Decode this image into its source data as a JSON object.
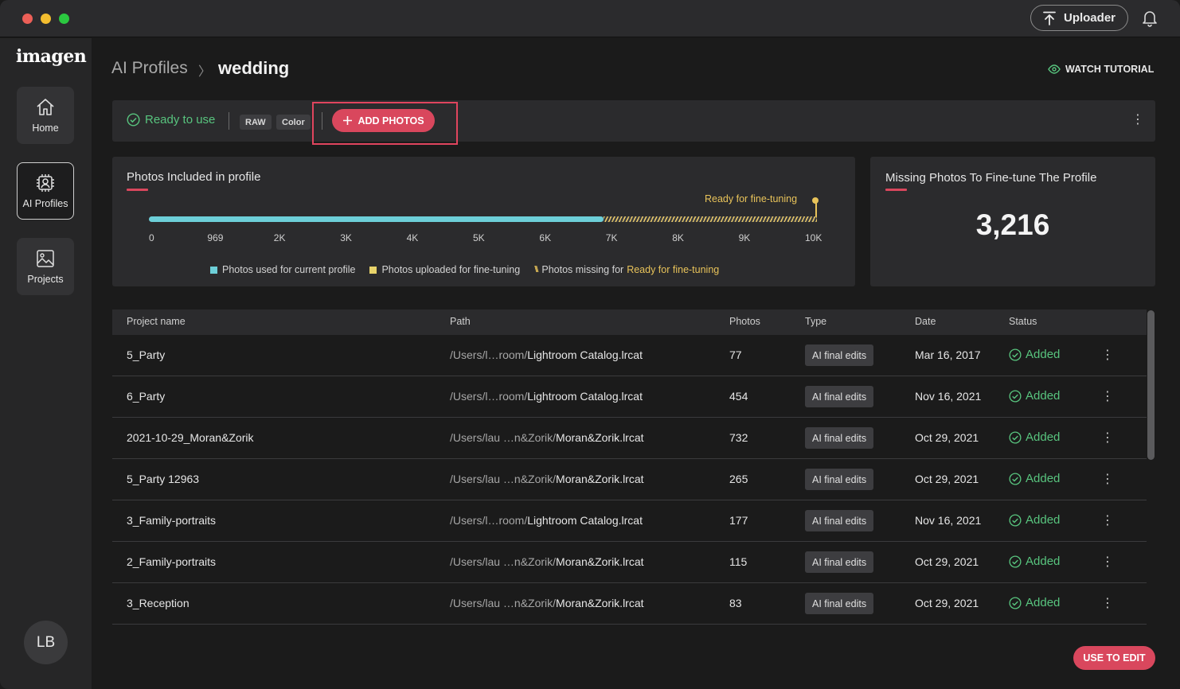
{
  "titlebar": {
    "uploader_label": "Uploader"
  },
  "sidebar": {
    "logo": "imagen",
    "items": [
      {
        "label": "Home",
        "icon": "home-icon"
      },
      {
        "label": "AI Profiles",
        "icon": "ai-profile-icon"
      },
      {
        "label": "Projects",
        "icon": "image-icon"
      }
    ],
    "avatar_initials": "LB"
  },
  "header": {
    "breadcrumb_root": "AI Profiles",
    "breadcrumb_sep": "〉",
    "breadcrumb_current": "wedding",
    "tutorial_label": "WATCH TUTORIAL"
  },
  "toolbar": {
    "status_label": "Ready to use",
    "tag_raw": "RAW",
    "tag_color": "Color",
    "add_photos_label": "ADD PHOTOS"
  },
  "progress_card": {
    "title": "Photos Included in profile",
    "goal_label": "Ready for fine-tuning",
    "ticks": [
      "0",
      "969",
      "2K",
      "3K",
      "4K",
      "5K",
      "6K",
      "7K",
      "8K",
      "9K",
      "10K"
    ],
    "current_fraction": 0.68,
    "goal_fraction": 1.0,
    "legend": {
      "used": "Photos used for current profile",
      "uploaded": "Photos uploaded for fine-tuning",
      "missing_prefix": "Photos missing for",
      "missing_highlight": "Ready for fine-tuning"
    },
    "colors": {
      "used": "#6dcfd8",
      "uploaded": "#e8d36a",
      "missing": "#e8c35a"
    }
  },
  "missing_card": {
    "title": "Missing Photos To Fine-tune The Profile",
    "value": "3,216"
  },
  "table": {
    "columns": [
      "Project name",
      "Path",
      "Photos",
      "Type",
      "Date",
      "Status"
    ],
    "rows": [
      {
        "name": "5_Party",
        "path_prefix": "/Users/l…room/",
        "path_file": "Lightroom Catalog.lrcat",
        "photos": "77",
        "type": "AI final edits",
        "date": "Mar 16, 2017",
        "status": "Added"
      },
      {
        "name": "6_Party",
        "path_prefix": "/Users/l…room/",
        "path_file": "Lightroom Catalog.lrcat",
        "photos": "454",
        "type": "AI final edits",
        "date": "Nov 16, 2021",
        "status": "Added"
      },
      {
        "name": "2021-10-29_Moran&Zorik",
        "path_prefix": "/Users/lau  …n&Zorik/",
        "path_file": "Moran&Zorik.lrcat",
        "photos": "732",
        "type": "AI final edits",
        "date": "Oct 29, 2021",
        "status": "Added"
      },
      {
        "name": "5_Party 12963",
        "path_prefix": "/Users/lau  …n&Zorik/",
        "path_file": "Moran&Zorik.lrcat",
        "photos": "265",
        "type": "AI final edits",
        "date": "Oct 29, 2021",
        "status": "Added"
      },
      {
        "name": "3_Family-portraits",
        "path_prefix": "/Users/l…room/",
        "path_file": "Lightroom Catalog.lrcat",
        "photos": "177",
        "type": "AI final edits",
        "date": "Nov 16, 2021",
        "status": "Added"
      },
      {
        "name": "2_Family-portraits",
        "path_prefix": "/Users/lau  …n&Zorik/",
        "path_file": "Moran&Zorik.lrcat",
        "photos": "115",
        "type": "AI final edits",
        "date": "Oct 29, 2021",
        "status": "Added"
      },
      {
        "name": "3_Reception",
        "path_prefix": "/Users/lau  …n&Zorik/",
        "path_file": "Moran&Zorik.lrcat",
        "photos": "83",
        "type": "AI final edits",
        "date": "Oct 29, 2021",
        "status": "Added"
      }
    ]
  },
  "footer": {
    "use_to_edit_label": "USE TO EDIT"
  }
}
